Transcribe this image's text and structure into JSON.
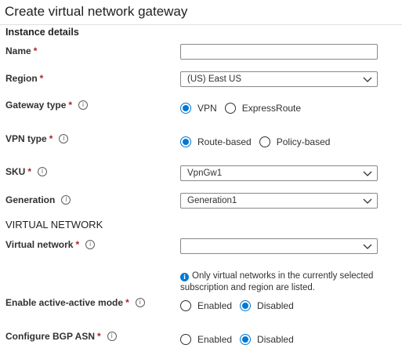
{
  "page": {
    "title": "Create virtual network gateway"
  },
  "sections": {
    "instance_details": "Instance details",
    "virtual_network": "VIRTUAL NETWORK"
  },
  "fields": {
    "name": {
      "label": "Name",
      "required": "*",
      "value": ""
    },
    "region": {
      "label": "Region",
      "required": "*",
      "value": "(US) East US"
    },
    "gateway_type": {
      "label": "Gateway type",
      "required": "*",
      "info_icon": "info-icon",
      "options": [
        {
          "label": "VPN",
          "selected": true
        },
        {
          "label": "ExpressRoute",
          "selected": false
        }
      ]
    },
    "vpn_type": {
      "label": "VPN type",
      "required": "*",
      "info_icon": "info-icon",
      "options": [
        {
          "label": "Route-based",
          "selected": true
        },
        {
          "label": "Policy-based",
          "selected": false
        }
      ]
    },
    "sku": {
      "label": "SKU",
      "required": "*",
      "value": "VpnGw1"
    },
    "generation": {
      "label": "Generation",
      "value": "Generation1"
    },
    "virtual_network": {
      "label": "Virtual network",
      "required": "*",
      "value": ""
    },
    "vnet_note": "Only virtual networks in the currently selected subscription and region are listed.",
    "active_active": {
      "label": "Enable active-active mode",
      "required": "*",
      "options": [
        {
          "label": "Enabled",
          "selected": false
        },
        {
          "label": "Disabled",
          "selected": true
        }
      ]
    },
    "bgp_asn": {
      "label": "Configure BGP ASN",
      "required": "*",
      "options": [
        {
          "label": "Enabled",
          "selected": false
        },
        {
          "label": "Disabled",
          "selected": true
        }
      ]
    }
  },
  "colors": {
    "accent": "#0078d4",
    "required": "#a4262c",
    "text": "#323130",
    "border": "#8a8886"
  }
}
